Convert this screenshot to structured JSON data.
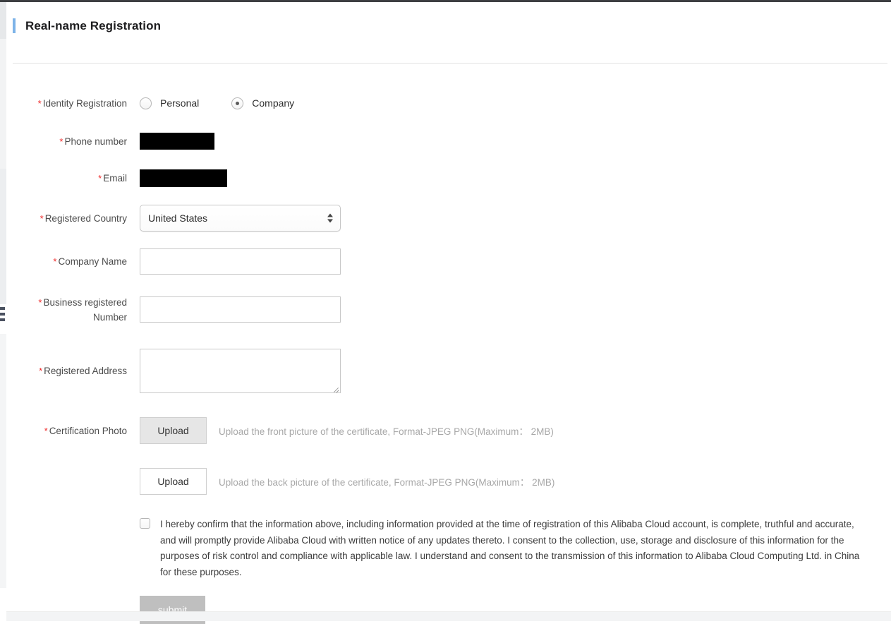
{
  "page": {
    "title": "Real-name Registration",
    "accent_color": "#7db3e8"
  },
  "form": {
    "identity": {
      "label": "Identity Registration",
      "options": [
        {
          "label": "Personal",
          "selected": false
        },
        {
          "label": "Company",
          "selected": true
        }
      ]
    },
    "phone": {
      "label": "Phone number",
      "value": "",
      "redacted": true
    },
    "email": {
      "label": "Email",
      "value": "",
      "redacted": true
    },
    "country": {
      "label": "Registered Country",
      "value": "United States"
    },
    "company_name": {
      "label": "Company Name",
      "value": "",
      "placeholder": ""
    },
    "business_number": {
      "label_line1": "Business registered",
      "label_line2": "Number",
      "value": "",
      "placeholder": ""
    },
    "address": {
      "label": "Registered Address",
      "value": "",
      "placeholder": ""
    },
    "certification_photo": {
      "label": "Certification Photo",
      "front": {
        "button_label": "Upload",
        "hint": "Upload the front picture of the certificate, Format-JPEG PNG(Maximum： 2MB)"
      },
      "back": {
        "button_label": "Upload",
        "hint": "Upload the back picture of the certificate, Format-JPEG PNG(Maximum： 2MB)"
      }
    },
    "consent": {
      "checked": false,
      "text": "I hereby confirm that the information above, including information provided at the time of registration of this Alibaba Cloud account, is complete, truthful and accurate, and will promptly provide Alibaba Cloud with written notice of any updates thereto. I consent to the collection, use, storage and disclosure of this information for the purposes of risk control and compliance with applicable law. I understand and consent to the transmission of this information to Alibaba Cloud Computing Ltd. in China for these purposes."
    },
    "submit": {
      "label": "submit",
      "disabled": true
    },
    "required_marker": "*"
  }
}
